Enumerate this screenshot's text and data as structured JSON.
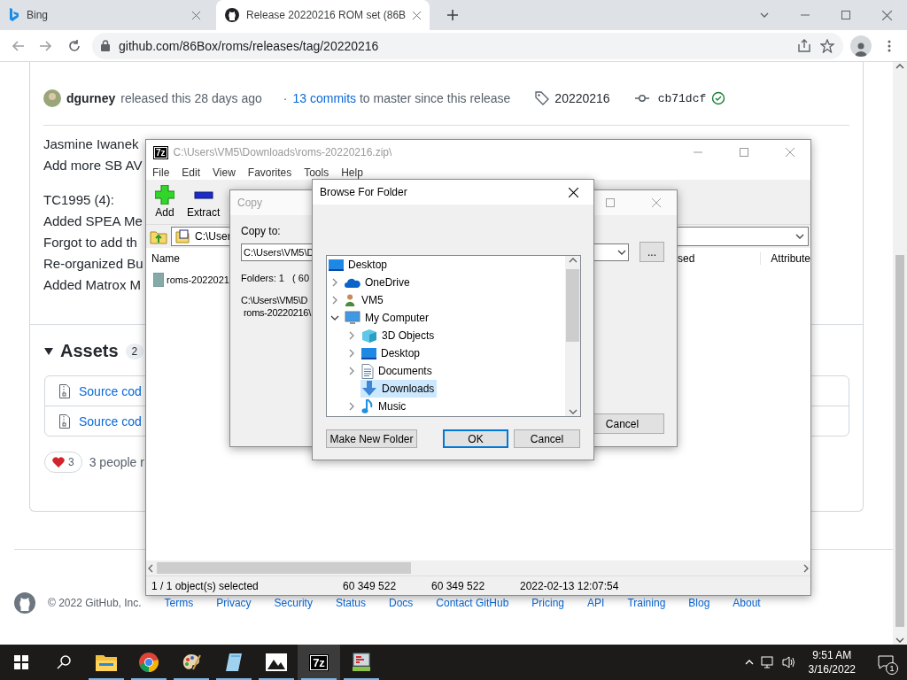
{
  "browser": {
    "tabs": [
      {
        "title": "Bing",
        "selected": false
      },
      {
        "title": "Release 20220216 ROM set (86B",
        "selected": true
      }
    ],
    "address": "github.com/86Box/roms/releases/tag/20220216"
  },
  "release": {
    "author": "dgurney",
    "released": "released this 28 days ago",
    "dot": "·",
    "commits_link": "13 commits",
    "commits_text": "to master since this release",
    "tag": "20220216",
    "commit": "cb71dcf",
    "notes": [
      [
        "Jasmine Iwanek",
        "Add more SB AV"
      ],
      [
        "TC1995 (4):",
        "Added SPEA Me",
        "Forgot to add th",
        "Re-organized Bu",
        "Added Matrox M"
      ]
    ],
    "assets": {
      "title": "Assets",
      "count": "2",
      "items": [
        "Source cod",
        "Source cod"
      ]
    },
    "reaction": {
      "count": "3",
      "text": "3 people r"
    }
  },
  "footer": {
    "copyright": "© 2022 GitHub, Inc.",
    "links": [
      "Terms",
      "Privacy",
      "Security",
      "Status",
      "Docs",
      "Contact GitHub",
      "Pricing",
      "API",
      "Training",
      "Blog",
      "About"
    ]
  },
  "archiver": {
    "logo": "7z",
    "title": "C:\\Users\\VM5\\Downloads\\roms-20220216.zip\\",
    "menu": [
      "File",
      "Edit",
      "View",
      "Favorites",
      "Tools",
      "Help"
    ],
    "tools": [
      {
        "label": "Add",
        "kind": "add"
      },
      {
        "label": "Extract",
        "kind": "extract"
      }
    ],
    "path": "C:\\User",
    "columns": [
      "Name",
      "sed",
      "Attribute"
    ],
    "rows": [
      "roms-2022021"
    ],
    "status": [
      "1 / 1 object(s) selected",
      "60 349 522",
      "60 349 522",
      "2022-02-13 12:07:54"
    ]
  },
  "copy_dialog": {
    "title": "Copy",
    "copy_to_label": "Copy to:",
    "copy_to_value": "C:\\Users\\VM5\\D",
    "browse": "...",
    "folders": "Folders: 1   ( 60",
    "path_lines": [
      "C:\\Users\\VM5\\D",
      "roms-20220216\\"
    ],
    "cancel": "Cancel"
  },
  "browse_dialog": {
    "title": "Browse For Folder",
    "tree": [
      {
        "label": "Desktop",
        "kind": "desktop",
        "selected": false,
        "children": [
          {
            "label": "OneDrive",
            "kind": "cloud",
            "expanded": false,
            "selected": false
          },
          {
            "label": "VM5",
            "kind": "user",
            "expanded": false,
            "selected": false
          },
          {
            "label": "My Computer",
            "kind": "computer",
            "expanded": true,
            "selected": false,
            "children": [
              {
                "label": "3D Objects",
                "kind": "cube",
                "expanded": false,
                "selected": false
              },
              {
                "label": "Desktop",
                "kind": "desktop",
                "expanded": false,
                "selected": false
              },
              {
                "label": "Documents",
                "kind": "documents",
                "expanded": false,
                "selected": false
              },
              {
                "label": "Downloads",
                "kind": "download",
                "selected": true
              },
              {
                "label": "Music",
                "kind": "music",
                "expanded": false,
                "selected": false
              }
            ]
          }
        ]
      }
    ],
    "buttons": [
      {
        "label": "Make New Folder",
        "default": false
      },
      {
        "label": "OK",
        "default": true
      },
      {
        "label": "Cancel",
        "default": false
      }
    ]
  },
  "taskbar": {
    "apps": [
      {
        "kind": "explorer",
        "selected": false
      },
      {
        "kind": "chrome",
        "selected": false
      },
      {
        "kind": "paint",
        "selected": false
      },
      {
        "kind": "notepad",
        "selected": false
      },
      {
        "kind": "photos",
        "selected": false
      },
      {
        "kind": "sevenzip",
        "label": "7z",
        "selected": true
      },
      {
        "kind": "monitor",
        "selected": false
      }
    ],
    "time": "9:51 AM",
    "date": "3/16/2022",
    "notifications": "1"
  }
}
